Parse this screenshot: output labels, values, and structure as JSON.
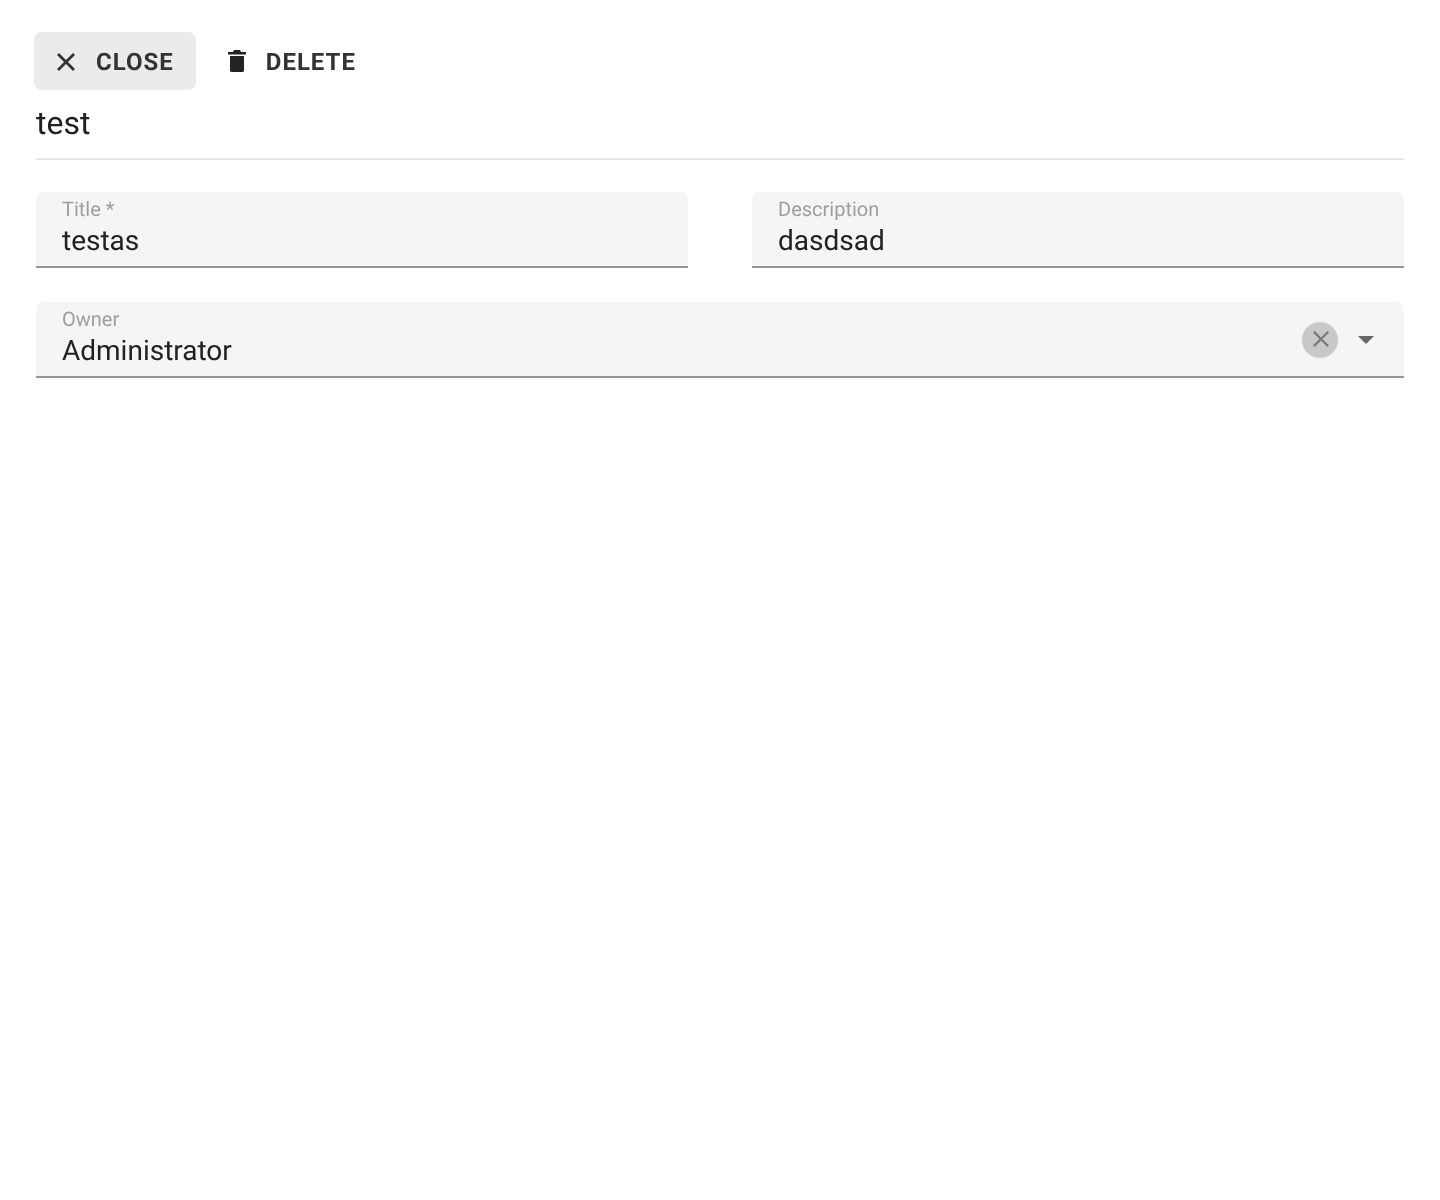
{
  "toolbar": [
    {
      "kind": "close",
      "label": "CLOSE"
    },
    {
      "kind": "delete",
      "label": "DELETE"
    }
  ],
  "title": "test",
  "fields": [
    {
      "label": "Title *",
      "value": "testas"
    },
    {
      "label": "Description",
      "value": "dasdsad"
    }
  ],
  "owner": {
    "label": "Owner",
    "value": "Administrator"
  }
}
